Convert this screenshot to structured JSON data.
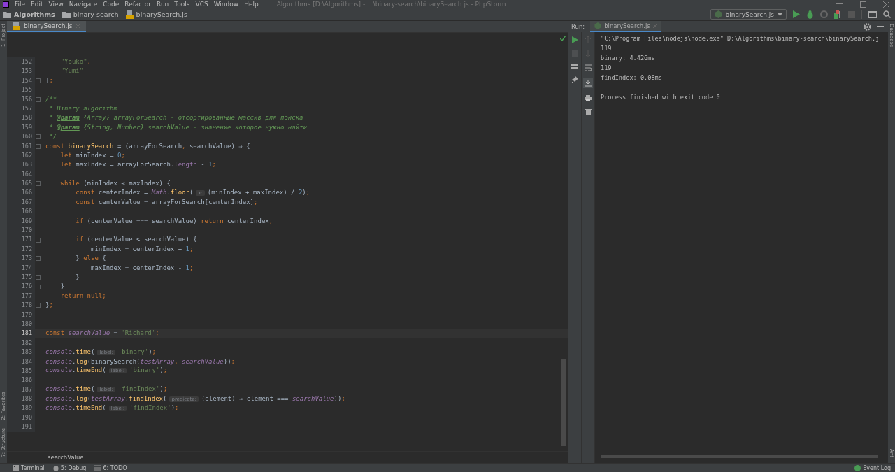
{
  "menu": [
    "File",
    "Edit",
    "View",
    "Navigate",
    "Code",
    "Refactor",
    "Run",
    "Tools",
    "VCS",
    "Window",
    "Help"
  ],
  "window": {
    "title": "Algorithms [D:\\Algorithms] - ...\\binary-search\\binarySearch.js - PhpStorm"
  },
  "breadcrumbs": [
    {
      "label": "Algorithms",
      "kind": "project"
    },
    {
      "label": "binary-search",
      "kind": "folder"
    },
    {
      "label": "binarySearch.js",
      "kind": "file"
    }
  ],
  "run_config": {
    "label": "binarySearch.js"
  },
  "left_tool_tabs": {
    "top": [
      {
        "label": "1: Project"
      }
    ],
    "bottom": [
      {
        "label": "2: Favorites"
      },
      {
        "label": "7: Structure"
      }
    ]
  },
  "right_tool_tabs": {
    "top": [
      {
        "label": "Database"
      }
    ],
    "bottom": [
      {
        "label": "Ant"
      }
    ]
  },
  "editor_tabs": [
    {
      "label": "binarySearch.js",
      "selected": true
    }
  ],
  "code_lines": [
    {
      "number": "152",
      "current": false,
      "fold": false,
      "tokens": [
        {
          "kind": "str",
          "text": "    \"Youko\""
        },
        {
          "kind": "kw",
          "text": ","
        }
      ]
    },
    {
      "number": "153",
      "current": false,
      "fold": false,
      "tokens": [
        {
          "kind": "str",
          "text": "    \"Yumi\""
        }
      ]
    },
    {
      "number": "154",
      "current": false,
      "fold": true,
      "tokens": [
        {
          "kind": "p",
          "text": "]"
        },
        {
          "kind": "kw",
          "text": ";"
        }
      ]
    },
    {
      "number": "155",
      "current": false,
      "fold": false
    },
    {
      "number": "156",
      "current": false,
      "fold": true,
      "tokens": [
        {
          "kind": "cm",
          "text": "/**"
        }
      ]
    },
    {
      "number": "157",
      "current": false,
      "fold": false,
      "tokens": [
        {
          "kind": "cm",
          "text": " * Binary algorithm"
        }
      ]
    },
    {
      "number": "158",
      "current": false,
      "fold": false,
      "tokens": [
        {
          "kind": "cm",
          "text": " * "
        },
        {
          "kind": "tag",
          "text": "@param"
        },
        {
          "kind": "cm",
          "text": " {Array} arrayForSearch - отсортированные массив для поиска"
        }
      ]
    },
    {
      "number": "159",
      "current": false,
      "fold": false,
      "tokens": [
        {
          "kind": "cm",
          "text": " * "
        },
        {
          "kind": "tag",
          "text": "@param"
        },
        {
          "kind": "cm",
          "text": " {String, Number} searchValue - значение которое нужно найти"
        }
      ]
    },
    {
      "number": "160",
      "current": false,
      "fold": true,
      "tokens": [
        {
          "kind": "cm",
          "text": " */"
        }
      ]
    },
    {
      "number": "161",
      "current": false,
      "fold": true,
      "tokens": [
        {
          "kind": "kw",
          "text": "const "
        },
        {
          "kind": "fn",
          "text": "binarySearch"
        },
        {
          "kind": "p",
          "text": " = (arrayForSearch"
        },
        {
          "kind": "kw",
          "text": ","
        },
        {
          "kind": "p",
          "text": " searchValue) ⇒ {"
        }
      ]
    },
    {
      "number": "162",
      "current": false,
      "fold": false,
      "tokens": [
        {
          "kind": "kw",
          "text": "    let "
        },
        {
          "kind": "p",
          "text": "minIndex = "
        },
        {
          "kind": "num",
          "text": "0"
        },
        {
          "kind": "kw",
          "text": ";"
        }
      ]
    },
    {
      "number": "163",
      "current": false,
      "fold": false,
      "tokens": [
        {
          "kind": "kw",
          "text": "    let "
        },
        {
          "kind": "p",
          "text": "maxIndex = arrayForSearch."
        },
        {
          "kind": "prop",
          "text": "length"
        },
        {
          "kind": "p",
          "text": " - "
        },
        {
          "kind": "num",
          "text": "1"
        },
        {
          "kind": "kw",
          "text": ";"
        }
      ]
    },
    {
      "number": "164",
      "current": false,
      "fold": false
    },
    {
      "number": "165",
      "current": false,
      "fold": true,
      "tokens": [
        {
          "kind": "kw",
          "text": "    while "
        },
        {
          "kind": "p",
          "text": "(minIndex ≤ maxIndex) {"
        }
      ]
    },
    {
      "number": "166",
      "current": false,
      "fold": false,
      "tokens": [
        {
          "kind": "kw",
          "text": "        const "
        },
        {
          "kind": "p",
          "text": "centerIndex = "
        },
        {
          "kind": "glob",
          "text": "Math"
        },
        {
          "kind": "p",
          "text": "."
        },
        {
          "kind": "call",
          "text": "floor"
        },
        {
          "kind": "p",
          "text": "("
        },
        {
          "kind": "hint",
          "text": "x:"
        },
        {
          "kind": "p",
          "text": "(minIndex + maxIndex) / "
        },
        {
          "kind": "num",
          "text": "2"
        },
        {
          "kind": "p",
          "text": ")"
        },
        {
          "kind": "kw",
          "text": ";"
        }
      ]
    },
    {
      "number": "167",
      "current": false,
      "fold": false,
      "tokens": [
        {
          "kind": "kw",
          "text": "        const "
        },
        {
          "kind": "p",
          "text": "centerValue = arrayForSearch[centerIndex]"
        },
        {
          "kind": "kw",
          "text": ";"
        }
      ]
    },
    {
      "number": "168",
      "current": false,
      "fold": false
    },
    {
      "number": "169",
      "current": false,
      "fold": false,
      "tokens": [
        {
          "kind": "kw",
          "text": "        if "
        },
        {
          "kind": "p",
          "text": "(centerValue === searchValue) "
        },
        {
          "kind": "kw",
          "text": "return "
        },
        {
          "kind": "p",
          "text": "centerIndex"
        },
        {
          "kind": "kw",
          "text": ";"
        }
      ]
    },
    {
      "number": "170",
      "current": false,
      "fold": false
    },
    {
      "number": "171",
      "current": false,
      "fold": true,
      "tokens": [
        {
          "kind": "kw",
          "text": "        if "
        },
        {
          "kind": "p",
          "text": "(centerValue < searchValue) {"
        }
      ]
    },
    {
      "number": "172",
      "current": false,
      "fold": false,
      "tokens": [
        {
          "kind": "p",
          "text": "            minIndex = centerIndex + "
        },
        {
          "kind": "num",
          "text": "1"
        },
        {
          "kind": "kw",
          "text": ";"
        }
      ]
    },
    {
      "number": "173",
      "current": false,
      "fold": true,
      "tokens": [
        {
          "kind": "p",
          "text": "        } "
        },
        {
          "kind": "kw",
          "text": "else "
        },
        {
          "kind": "p",
          "text": "{"
        }
      ]
    },
    {
      "number": "174",
      "current": false,
      "fold": false,
      "tokens": [
        {
          "kind": "p",
          "text": "            maxIndex = centerIndex - "
        },
        {
          "kind": "num",
          "text": "1"
        },
        {
          "kind": "kw",
          "text": ";"
        }
      ]
    },
    {
      "number": "175",
      "current": false,
      "fold": true,
      "tokens": [
        {
          "kind": "p",
          "text": "        }"
        }
      ]
    },
    {
      "number": "176",
      "current": false,
      "fold": true,
      "tokens": [
        {
          "kind": "p",
          "text": "    }"
        }
      ]
    },
    {
      "number": "177",
      "current": false,
      "fold": false,
      "tokens": [
        {
          "kind": "kw",
          "text": "    return null;"
        }
      ]
    },
    {
      "number": "178",
      "current": false,
      "fold": true,
      "tokens": [
        {
          "kind": "p",
          "text": "}"
        },
        {
          "kind": "kw",
          "text": ";"
        }
      ]
    },
    {
      "number": "179",
      "current": false,
      "fold": false
    },
    {
      "number": "180",
      "current": false,
      "fold": false
    },
    {
      "number": "181",
      "current": true,
      "fold": false,
      "tokens": [
        {
          "kind": "kw",
          "text": "const "
        },
        {
          "kind": "it",
          "text": "searchValue"
        },
        {
          "kind": "p",
          "text": " = "
        },
        {
          "kind": "str",
          "text": "'Richard'"
        },
        {
          "kind": "kw",
          "text": ";"
        }
      ]
    },
    {
      "number": "182",
      "current": false,
      "fold": false
    },
    {
      "number": "183",
      "current": false,
      "fold": false,
      "tokens": [
        {
          "kind": "glob",
          "text": "console"
        },
        {
          "kind": "p",
          "text": "."
        },
        {
          "kind": "call",
          "text": "time"
        },
        {
          "kind": "p",
          "text": "("
        },
        {
          "kind": "hint",
          "text": "label:"
        },
        {
          "kind": "str",
          "text": "'binary'"
        },
        {
          "kind": "p",
          "text": ")"
        },
        {
          "kind": "kw",
          "text": ";"
        }
      ]
    },
    {
      "number": "184",
      "current": false,
      "fold": false,
      "tokens": [
        {
          "kind": "glob",
          "text": "console"
        },
        {
          "kind": "p",
          "text": "."
        },
        {
          "kind": "call",
          "text": "log"
        },
        {
          "kind": "p",
          "text": "(binarySearch("
        },
        {
          "kind": "it",
          "text": "testArray"
        },
        {
          "kind": "kw",
          "text": ", "
        },
        {
          "kind": "it",
          "text": "searchValue"
        },
        {
          "kind": "p",
          "text": "))"
        },
        {
          "kind": "kw",
          "text": ";"
        }
      ]
    },
    {
      "number": "185",
      "current": false,
      "fold": false,
      "tokens": [
        {
          "kind": "glob",
          "text": "console"
        },
        {
          "kind": "p",
          "text": "."
        },
        {
          "kind": "call",
          "text": "timeEnd"
        },
        {
          "kind": "p",
          "text": "("
        },
        {
          "kind": "hint",
          "text": "label:"
        },
        {
          "kind": "str",
          "text": "'binary'"
        },
        {
          "kind": "p",
          "text": ")"
        },
        {
          "kind": "kw",
          "text": ";"
        }
      ]
    },
    {
      "number": "186",
      "current": false,
      "fold": false
    },
    {
      "number": "187",
      "current": false,
      "fold": false,
      "tokens": [
        {
          "kind": "glob",
          "text": "console"
        },
        {
          "kind": "p",
          "text": "."
        },
        {
          "kind": "call",
          "text": "time"
        },
        {
          "kind": "p",
          "text": "("
        },
        {
          "kind": "hint",
          "text": "label:"
        },
        {
          "kind": "str",
          "text": "'findIndex'"
        },
        {
          "kind": "p",
          "text": ")"
        },
        {
          "kind": "kw",
          "text": ";"
        }
      ]
    },
    {
      "number": "188",
      "current": false,
      "fold": false,
      "tokens": [
        {
          "kind": "glob",
          "text": "console"
        },
        {
          "kind": "p",
          "text": "."
        },
        {
          "kind": "call",
          "text": "log"
        },
        {
          "kind": "p",
          "text": "("
        },
        {
          "kind": "it",
          "text": "testArray"
        },
        {
          "kind": "p",
          "text": "."
        },
        {
          "kind": "call",
          "text": "findIndex"
        },
        {
          "kind": "p",
          "text": "("
        },
        {
          "kind": "hint",
          "text": "predicate:"
        },
        {
          "kind": "p",
          "text": "(element) ⇒ element === "
        },
        {
          "kind": "it",
          "text": "searchValue"
        },
        {
          "kind": "p",
          "text": "))"
        },
        {
          "kind": "kw",
          "text": ";"
        }
      ]
    },
    {
      "number": "189",
      "current": false,
      "fold": false,
      "tokens": [
        {
          "kind": "glob",
          "text": "console"
        },
        {
          "kind": "p",
          "text": "."
        },
        {
          "kind": "call",
          "text": "timeEnd"
        },
        {
          "kind": "p",
          "text": "("
        },
        {
          "kind": "hint",
          "text": "label:"
        },
        {
          "kind": "str",
          "text": "'findIndex'"
        },
        {
          "kind": "p",
          "text": ")"
        },
        {
          "kind": "kw",
          "text": ";"
        }
      ]
    },
    {
      "number": "190",
      "current": false,
      "fold": false
    },
    {
      "number": "191",
      "current": false,
      "fold": false
    }
  ],
  "editor_breadcrumb": "searchValue",
  "run_panel": {
    "label": "Run:",
    "tabs": [
      {
        "label": "binarySearch.js",
        "selected": true
      }
    ],
    "output": [
      {
        "kind": "command",
        "text": "\"C:\\Program Files\\nodejs\\node.exe\" D:\\Algorithms\\binary-search\\binarySearch.j"
      },
      {
        "kind": "stdout",
        "text": "119"
      },
      {
        "kind": "stdout",
        "text": "binary: 4.426ms"
      },
      {
        "kind": "stdout",
        "text": "119"
      },
      {
        "kind": "stdout",
        "text": "findIndex: 0.08ms"
      },
      {
        "kind": "exit",
        "text": "Process finished with exit code 0"
      }
    ]
  },
  "status_tools": [
    {
      "label": "Terminal",
      "kind": "terminal"
    },
    {
      "label": "5: Debug",
      "kind": "debug"
    },
    {
      "label": "6: TODO",
      "kind": "todo"
    }
  ],
  "event_log": "Event Log"
}
